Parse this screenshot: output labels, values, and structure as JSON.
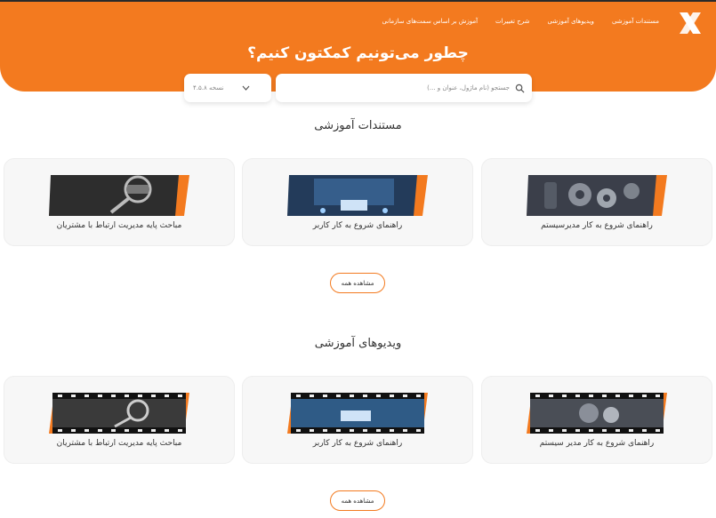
{
  "nav": {
    "items": [
      "مستندات آموزشی",
      "ویدیوهای آموزشی",
      "شرح تغییرات",
      "آموزش بر اساس سمت‌های سازمانی"
    ]
  },
  "hero": {
    "title": "چطور می‌تونیم کمکتون کنیم؟"
  },
  "search": {
    "placeholder": "جستجو (نام ماژول، عنوان و ...)",
    "version_label": "نسخه ۴.۵.۸"
  },
  "docs": {
    "title": "مستندات آموزشی",
    "cards": [
      {
        "label": "راهنمای شروع به کار مدیرسیستم",
        "thumb": "gears-photo"
      },
      {
        "label": "راهنمای شروع به کار کاربر",
        "thumb": "crm-tablet-photo"
      },
      {
        "label": "مباحث پایه مدیریت ارتباط با مشتریان",
        "thumb": "crm-magnifier-photo"
      }
    ],
    "more_label": "مشاهده همه"
  },
  "videos": {
    "title": "ویدیوهای آموزشی",
    "cards": [
      {
        "label": "راهنمای شروع به کار مدیر سیستم",
        "thumb": "gears-filmstrip"
      },
      {
        "label": "راهنمای شروع به کار کاربر",
        "thumb": "crm-tablet-filmstrip"
      },
      {
        "label": "مباحث پایه مدیریت ارتباط با مشتریان",
        "thumb": "crm-magnifier-filmstrip"
      }
    ],
    "more_label": "مشاهده همه"
  },
  "colors": {
    "accent": "#f37a1f"
  }
}
